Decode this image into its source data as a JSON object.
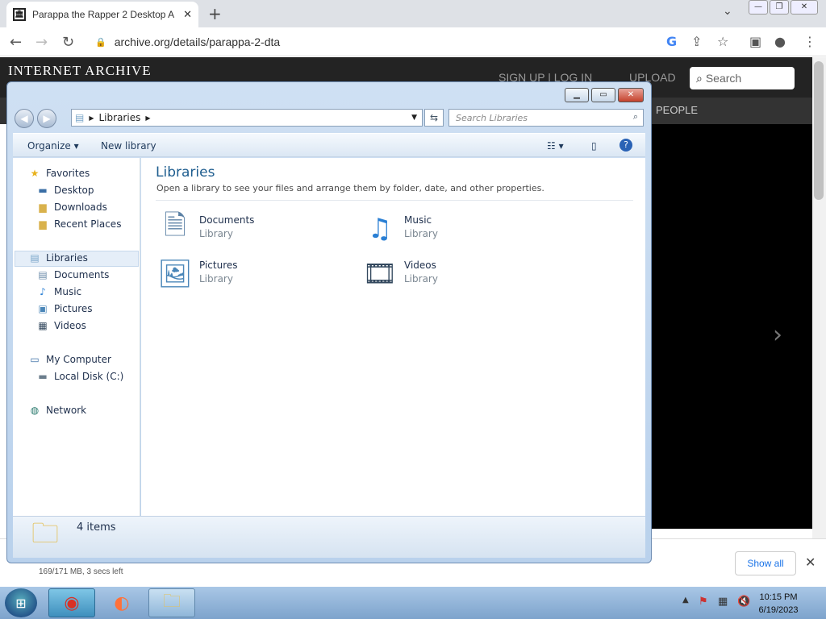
{
  "browser": {
    "tab_title": "Parappa the Rapper 2 Desktop A",
    "url": "archive.org/details/parappa-2-dta",
    "new_tab": "+",
    "tab_close": "✕"
  },
  "ia": {
    "logo": "INTERNET ARCHIVE",
    "signup": "SIGN UP | LOG IN",
    "upload": "UPLOAD",
    "search_placeholder": "Search",
    "people": "PEOPLE"
  },
  "download": {
    "info": "169/171 MB, 3 secs left",
    "show_all": "Show all"
  },
  "explorer": {
    "breadcrumb": "Libraries",
    "search_placeholder": "Search Libraries",
    "cmd": {
      "organize": "Organize ▾",
      "new_library": "New library"
    },
    "nav": {
      "favorites": "Favorites",
      "desktop": "Desktop",
      "downloads": "Downloads",
      "recent": "Recent Places",
      "libraries": "Libraries",
      "documents": "Documents",
      "music": "Music",
      "pictures": "Pictures",
      "videos": "Videos",
      "computer": "My Computer",
      "local_disk": "Local Disk (C:)",
      "network": "Network"
    },
    "title": "Libraries",
    "subtitle": "Open a library to see your files and arrange them by folder, date, and other properties.",
    "libraries": [
      {
        "name": "Documents",
        "type": "Library"
      },
      {
        "name": "Music",
        "type": "Library"
      },
      {
        "name": "Pictures",
        "type": "Library"
      },
      {
        "name": "Videos",
        "type": "Library"
      }
    ],
    "status": "4 items"
  },
  "taskbar": {
    "time": "10:15 PM",
    "date": "6/19/2023"
  },
  "colors": {
    "ia_dark": "#232323",
    "title_blue": "#1e5d8f"
  }
}
